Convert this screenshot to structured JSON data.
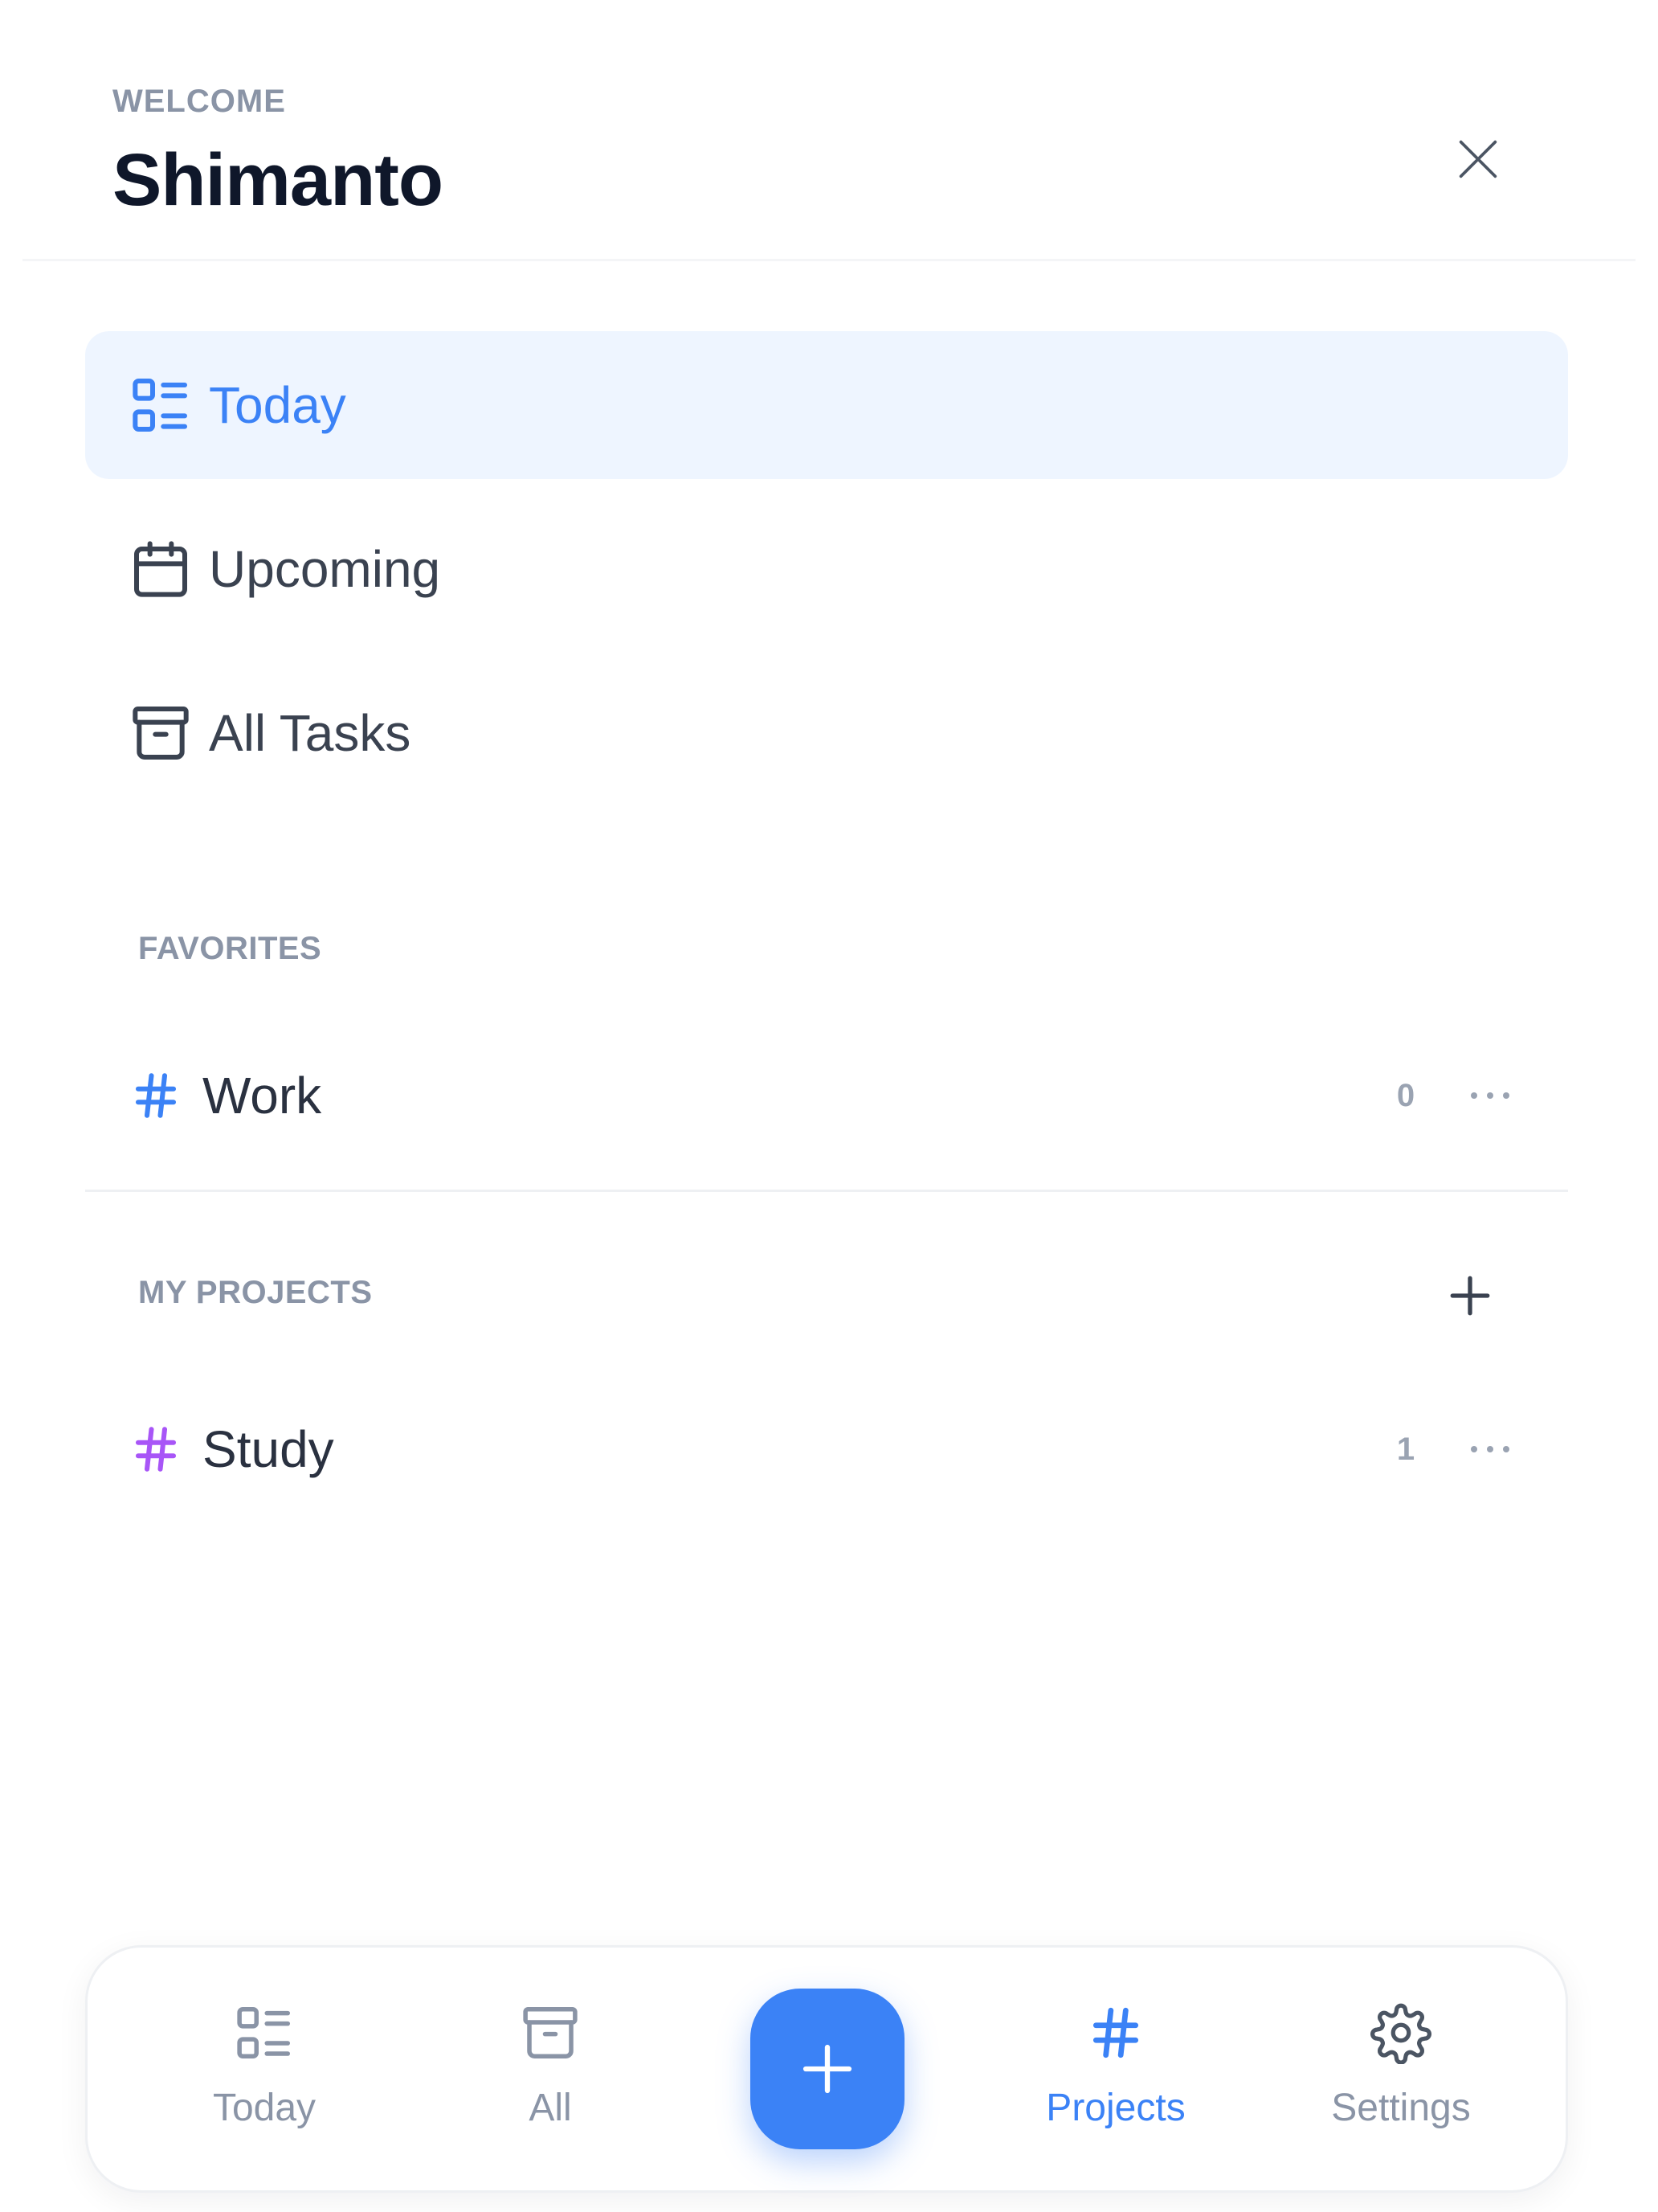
{
  "header": {
    "welcome_label": "WELCOME",
    "user_name": "Shimanto"
  },
  "nav": {
    "items": [
      {
        "label": "Today",
        "icon": "list-grid-icon",
        "active": true
      },
      {
        "label": "Upcoming",
        "icon": "calendar-icon",
        "active": false
      },
      {
        "label": "All Tasks",
        "icon": "archive-box-icon",
        "active": false
      }
    ]
  },
  "favorites": {
    "title": "FAVORITES",
    "items": [
      {
        "name": "Work",
        "count": "0",
        "hash_color": "#3b82f6"
      }
    ]
  },
  "projects": {
    "title": "MY PROJECTS",
    "items": [
      {
        "name": "Study",
        "count": "1",
        "hash_color": "#a855f7"
      }
    ]
  },
  "bottom_nav": {
    "tabs": [
      {
        "label": "Today",
        "icon": "list-grid-icon",
        "active": false
      },
      {
        "label": "All",
        "icon": "archive-box-icon",
        "active": false
      },
      {
        "label": "Projects",
        "icon": "hash-icon",
        "active": true
      },
      {
        "label": "Settings",
        "icon": "gear-icon",
        "active": false
      }
    ],
    "fab_icon": "plus-icon"
  },
  "colors": {
    "accent": "#3b82f6",
    "active_bg": "#eef5ff",
    "muted_text": "#8a94a6",
    "study_hash": "#a855f7"
  }
}
